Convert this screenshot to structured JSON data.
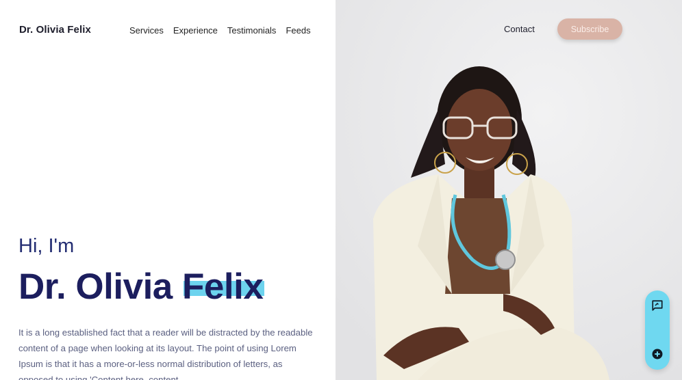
{
  "header": {
    "brand": "Dr. Olivia Felix",
    "nav": [
      "Services",
      "Experience",
      "Testimonials",
      "Feeds"
    ],
    "contact_label": "Contact",
    "subscribe_label": "Subscribe"
  },
  "hero": {
    "greeting": "Hi, I'm",
    "name_first": "Dr. Olivia",
    "name_last": "Felix",
    "paragraph": "It is a long established fact that a reader will be distracted by the readable content of a page when looking at its layout. The point of using Lorem Ipsum is that it has a more-or-less normal distribution of letters, as opposed to using 'Content here, content"
  },
  "floating_actions": {
    "icons": [
      "feedback-icon",
      "add-circle-icon"
    ]
  },
  "colors": {
    "accent": "#6dd3ee",
    "brand_navy": "#1c1e5e",
    "subscribe_bg": "#d9b3a6"
  }
}
